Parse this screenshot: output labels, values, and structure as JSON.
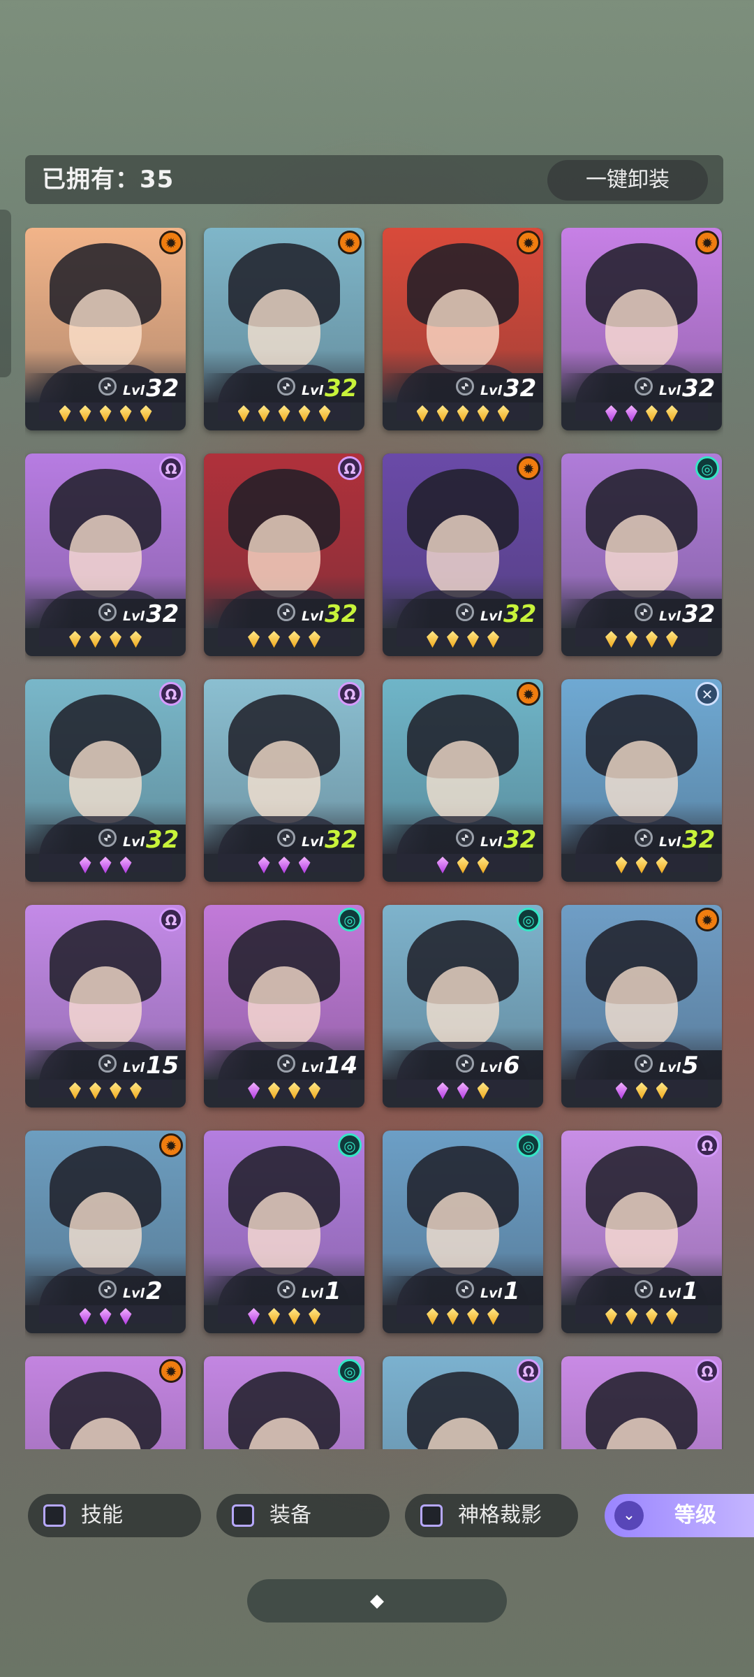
{
  "header": {
    "owned_label": "已拥有：35",
    "unequip_label": "一键卸装"
  },
  "lvl_prefix": "Lvl",
  "heroes": [
    {
      "level": "32",
      "level_color": "white",
      "faction": "sun-icon",
      "stars": [
        "gold",
        "gold",
        "gold",
        "gold",
        "gold"
      ],
      "bg": "#f2b489"
    },
    {
      "level": "32",
      "level_color": "green",
      "faction": "sun-icon",
      "stars": [
        "gold",
        "gold",
        "gold",
        "gold",
        "gold"
      ],
      "bg": "#7fb6c9"
    },
    {
      "level": "32",
      "level_color": "white",
      "faction": "sun-icon",
      "stars": [
        "gold",
        "gold",
        "gold",
        "gold",
        "gold"
      ],
      "bg": "#d94a3a"
    },
    {
      "level": "32",
      "level_color": "white",
      "faction": "sun-icon",
      "stars": [
        "purple",
        "purple",
        "gold",
        "gold"
      ],
      "bg": "#c780e6"
    },
    {
      "level": "32",
      "level_color": "white",
      "faction": "omega-icon",
      "stars": [
        "gold",
        "gold",
        "gold",
        "gold"
      ],
      "bg": "#b77ce2"
    },
    {
      "level": "32",
      "level_color": "green",
      "faction": "omega-icon",
      "stars": [
        "gold",
        "gold",
        "gold",
        "gold"
      ],
      "bg": "#b0313b"
    },
    {
      "level": "32",
      "level_color": "green",
      "faction": "sun-icon",
      "stars": [
        "gold",
        "gold",
        "gold",
        "gold"
      ],
      "bg": "#6a4aa8"
    },
    {
      "level": "32",
      "level_color": "white",
      "faction": "spiral-icon",
      "stars": [
        "gold",
        "gold",
        "gold",
        "gold"
      ],
      "bg": "#b07cd9"
    },
    {
      "level": "32",
      "level_color": "green",
      "faction": "omega-icon",
      "stars": [
        "purple",
        "purple",
        "purple"
      ],
      "bg": "#79b7c9"
    },
    {
      "level": "32",
      "level_color": "green",
      "faction": "omega-icon",
      "stars": [
        "purple",
        "purple",
        "purple"
      ],
      "bg": "#8bbfd1"
    },
    {
      "level": "32",
      "level_color": "green",
      "faction": "sun-icon",
      "stars": [
        "purple",
        "gold",
        "gold"
      ],
      "bg": "#6fb5c8"
    },
    {
      "level": "32",
      "level_color": "green",
      "faction": "cross-icon",
      "stars": [
        "gold",
        "gold",
        "gold"
      ],
      "bg": "#6fa9d3"
    },
    {
      "level": "15",
      "level_color": "white",
      "faction": "omega-icon",
      "stars": [
        "gold",
        "gold",
        "gold",
        "gold"
      ],
      "bg": "#c48ae8"
    },
    {
      "level": "14",
      "level_color": "white",
      "faction": "spiral-icon",
      "stars": [
        "purple",
        "gold",
        "gold",
        "gold"
      ],
      "bg": "#c27ad9"
    },
    {
      "level": "6",
      "level_color": "white",
      "faction": "spiral-icon",
      "stars": [
        "purple",
        "purple",
        "gold"
      ],
      "bg": "#7eb3cc"
    },
    {
      "level": "5",
      "level_color": "white",
      "faction": "sun-icon",
      "stars": [
        "purple",
        "gold",
        "gold"
      ],
      "bg": "#6f9ec6"
    },
    {
      "level": "2",
      "level_color": "white",
      "faction": "sun-icon",
      "stars": [
        "purple",
        "purple",
        "purple"
      ],
      "bg": "#6d9ec0"
    },
    {
      "level": "1",
      "level_color": "white",
      "faction": "spiral-icon",
      "stars": [
        "purple",
        "gold",
        "gold",
        "gold"
      ],
      "bg": "#b47ee0"
    },
    {
      "level": "1",
      "level_color": "white",
      "faction": "spiral-icon",
      "stars": [
        "gold",
        "gold",
        "gold",
        "gold"
      ],
      "bg": "#6c9fc6"
    },
    {
      "level": "1",
      "level_color": "white",
      "faction": "omega-icon",
      "stars": [
        "gold",
        "gold",
        "gold",
        "gold"
      ],
      "bg": "#c88ee6"
    },
    {
      "level": "",
      "level_color": "white",
      "faction": "sun-icon",
      "stars": [],
      "bg": "#c384e0"
    },
    {
      "level": "",
      "level_color": "white",
      "faction": "spiral-icon",
      "stars": [],
      "bg": "#c386e2"
    },
    {
      "level": "",
      "level_color": "white",
      "faction": "omega-icon",
      "stars": [],
      "bg": "#7bb1cf"
    },
    {
      "level": "",
      "level_color": "white",
      "faction": "omega-icon",
      "stars": [],
      "bg": "#c98ae5"
    }
  ],
  "filters": {
    "skill_label": "技能",
    "equip_label": "装备",
    "divine_label": "神格裁影",
    "sort_label": "等级"
  },
  "colors": {
    "accent_purple": "#9a85ff",
    "level_green": "#c8f33a",
    "gem_gold": "#f0a91c",
    "gem_purple": "#b23be2"
  }
}
